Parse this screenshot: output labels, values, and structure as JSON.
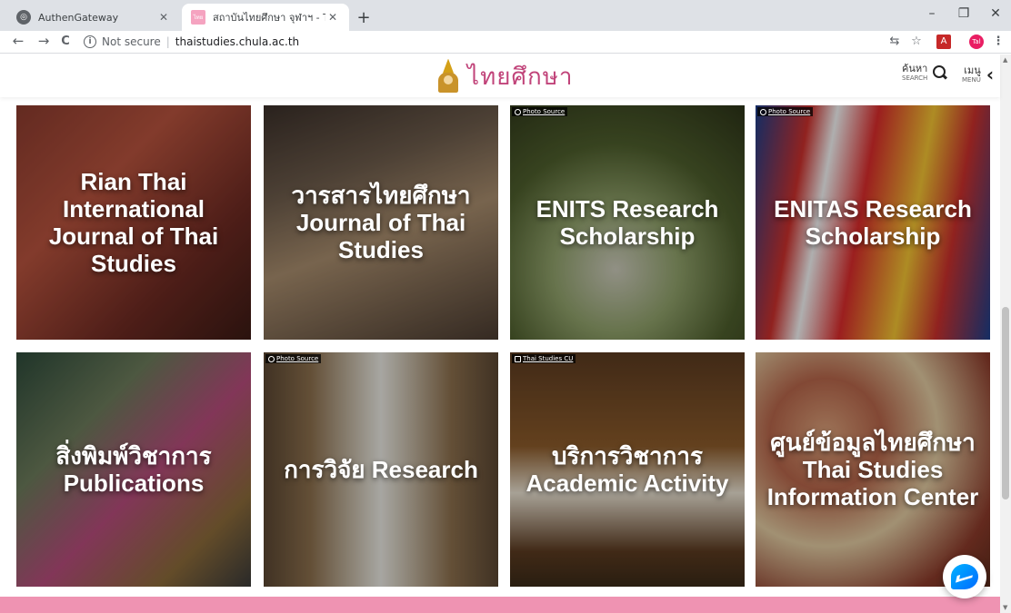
{
  "browser": {
    "tabs": [
      {
        "title": "AuthenGateway",
        "favicon": "globe-icon",
        "active": false
      },
      {
        "title": "สถาบันไทยศึกษา จุฬาฯ - Thai Studies",
        "favicon": "thai-studies-favicon",
        "active": true
      }
    ],
    "new_tab": "+",
    "window_controls": {
      "minimize": "–",
      "restore": "❐",
      "close": "✕"
    },
    "nav": {
      "back": "←",
      "forward": "→",
      "reload": "C"
    },
    "address": {
      "security": "Not secure",
      "separator": "|",
      "url": "thaistudies.chula.ac.th"
    },
    "toolbar_icons": {
      "translate": "⇆",
      "bookmark": "☆",
      "pdf_ext": "A",
      "profile": "Tal",
      "menu": "⋮"
    }
  },
  "header": {
    "logo_text": "ไทยศึกษา",
    "search": {
      "label_th": "ค้นหา",
      "label_en": "SEARCH"
    },
    "menu": {
      "label_th": "เมนู",
      "label_en": "MENU",
      "icon": "‹"
    }
  },
  "tiles": [
    {
      "title": "Rian Thai International Journal of Thai Studies",
      "credit": ""
    },
    {
      "title": "วารสารไทยศึกษา Journal of Thai Studies",
      "credit": ""
    },
    {
      "title": "ENITS Research Scholarship",
      "credit": "Photo Source"
    },
    {
      "title": "ENITAS Research Scholarship",
      "credit": "Photo Source"
    },
    {
      "title": "สิ่งพิมพ์วิชาการ Publications",
      "credit": ""
    },
    {
      "title": "การวิจัย Research",
      "credit": "Photo Source"
    },
    {
      "title": "บริการวิชาการ Academic Activity",
      "credit": "Thai Studies CU"
    },
    {
      "title": "ศูนย์ข้อมูลไทยศึกษา Thai Studies Information Center",
      "credit": ""
    }
  ],
  "colors": {
    "brand_pink": "#ef93b2",
    "logo_text": "#c1447a",
    "messenger_blue": "#0084ff"
  }
}
